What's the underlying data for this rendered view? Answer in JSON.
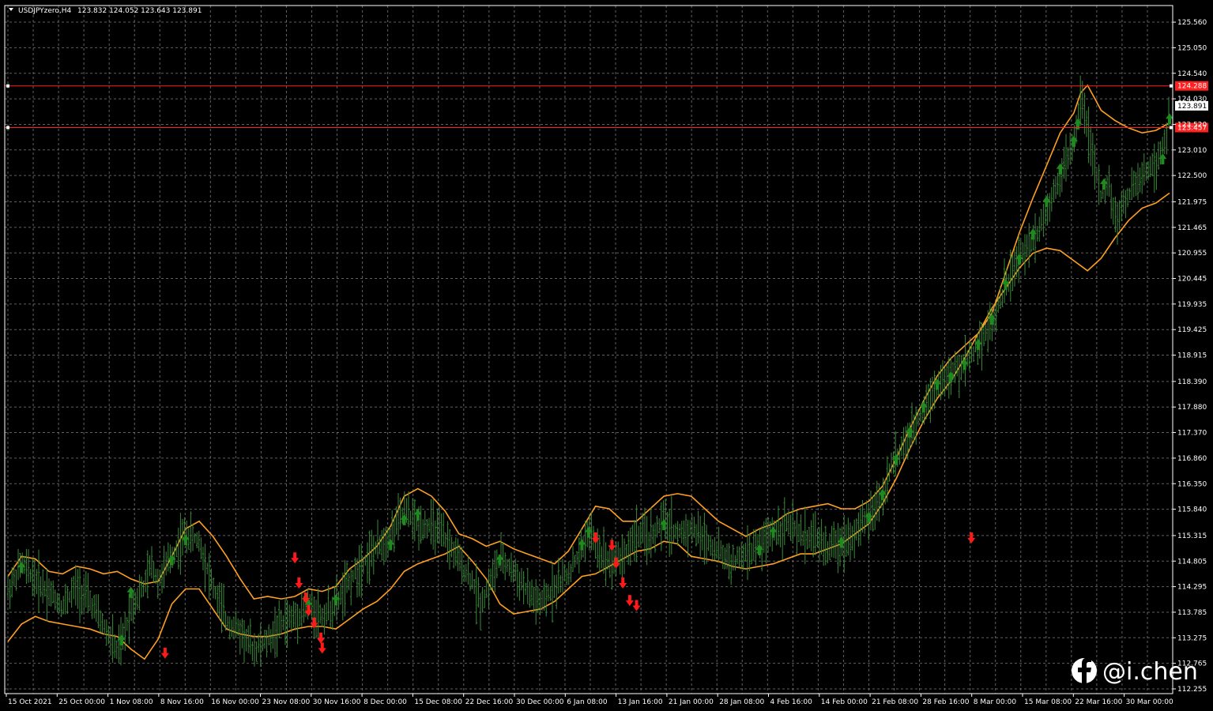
{
  "window": {
    "symbol_title": "USDJPYzero,H4",
    "ohlc_readout": "123.832 124.052 123.643 123.891"
  },
  "watermark": {
    "text": "@i.chen",
    "icon": "facebook-icon"
  },
  "colors": {
    "background": "#000000",
    "grid": "#7a7a7a",
    "axis": "#ffffff",
    "bars": "#3a8a3a",
    "band": "#ffa020",
    "buy_arrow": "#1f8a1f",
    "sell_arrow": "#ff1a1a",
    "hline": "#ff2020",
    "current_price_label_bg": "#ffffff"
  },
  "chart_data": {
    "type": "bar",
    "title": "USDJPYzero,H4",
    "timeframe": "H4",
    "ylim": [
      112.255,
      125.75
    ],
    "grid": true,
    "y_ticks": [
      "125.560",
      "125.050",
      "124.540",
      "124.030",
      "123.520",
      "123.010",
      "122.500",
      "121.975",
      "121.465",
      "120.955",
      "120.445",
      "119.935",
      "119.425",
      "118.915",
      "118.390",
      "117.880",
      "117.370",
      "116.860",
      "116.350",
      "115.840",
      "115.315",
      "114.805",
      "114.295",
      "113.785",
      "113.275",
      "112.765",
      "112.255"
    ],
    "x_ticks": [
      "15 Oct 2021",
      "25 Oct 00:00",
      "1 Nov 08:00",
      "8 Nov 16:00",
      "16 Nov 00:00",
      "23 Nov 08:00",
      "30 Nov 16:00",
      "8 Dec 00:00",
      "15 Dec 08:00",
      "22 Dec 16:00",
      "30 Dec 00:00",
      "6 Jan 08:00",
      "13 Jan 16:00",
      "21 Jan 00:00",
      "28 Jan 08:00",
      "4 Feb 16:00",
      "14 Feb 00:00",
      "21 Feb 08:00",
      "28 Feb 16:00",
      "8 Mar 00:00",
      "15 Mar 08:00",
      "22 Mar 16:00",
      "30 Mar 00:00"
    ],
    "price_path": [
      [
        0,
        114.2
      ],
      [
        1,
        114.75
      ],
      [
        2,
        114.45
      ],
      [
        3,
        114.2
      ],
      [
        4,
        113.9
      ],
      [
        5,
        114.3
      ],
      [
        6,
        114.0
      ],
      [
        7,
        113.5
      ],
      [
        8,
        113.0
      ],
      [
        8.4,
        113.2
      ],
      [
        9,
        113.9
      ],
      [
        10,
        114.3
      ],
      [
        10.5,
        114.75
      ],
      [
        11,
        114.4
      ],
      [
        12,
        114.9
      ],
      [
        13,
        115.35
      ],
      [
        14,
        115.2
      ],
      [
        15,
        114.3
      ],
      [
        16,
        113.6
      ],
      [
        17,
        113.4
      ],
      [
        18,
        113.05
      ],
      [
        19,
        113.2
      ],
      [
        20,
        113.55
      ],
      [
        21,
        113.7
      ],
      [
        22,
        113.9
      ],
      [
        23,
        113.7
      ],
      [
        24,
        113.95
      ],
      [
        25,
        114.4
      ],
      [
        26,
        114.8
      ],
      [
        27,
        115.05
      ],
      [
        27.5,
        115.2
      ],
      [
        28,
        115.35
      ],
      [
        29,
        115.8
      ],
      [
        30,
        115.55
      ],
      [
        31,
        115.5
      ],
      [
        32,
        115.25
      ],
      [
        33,
        114.8
      ],
      [
        34,
        114.4
      ],
      [
        34.6,
        113.95
      ],
      [
        35,
        114.2
      ],
      [
        36,
        114.85
      ],
      [
        37,
        114.6
      ],
      [
        38,
        114.2
      ],
      [
        39,
        113.9
      ],
      [
        40,
        114.3
      ],
      [
        41,
        114.55
      ],
      [
        42,
        115.05
      ],
      [
        42.5,
        115.45
      ],
      [
        43,
        115.1
      ],
      [
        44,
        114.8
      ],
      [
        45,
        114.9
      ],
      [
        46,
        115.35
      ],
      [
        47,
        115.25
      ],
      [
        48,
        115.6
      ],
      [
        49,
        115.35
      ],
      [
        50,
        115.45
      ],
      [
        51,
        115.25
      ],
      [
        52,
        115.0
      ],
      [
        53,
        114.75
      ],
      [
        54,
        114.95
      ],
      [
        55,
        115.1
      ],
      [
        56,
        115.4
      ],
      [
        57,
        115.55
      ],
      [
        58,
        115.3
      ],
      [
        59,
        115.3
      ],
      [
        60,
        115.05
      ],
      [
        61,
        115.2
      ],
      [
        62,
        115.35
      ],
      [
        63,
        115.7
      ],
      [
        64,
        116.1
      ],
      [
        64.5,
        116.6
      ],
      [
        65,
        116.9
      ],
      [
        66,
        117.25
      ],
      [
        67,
        117.9
      ],
      [
        68,
        118.35
      ],
      [
        69,
        118.5
      ],
      [
        70,
        118.75
      ],
      [
        71,
        119.15
      ],
      [
        72,
        119.55
      ],
      [
        73,
        120.3
      ],
      [
        74,
        120.85
      ],
      [
        75,
        121.2
      ],
      [
        76,
        121.8
      ],
      [
        77,
        122.55
      ],
      [
        78,
        123.1
      ],
      [
        78.3,
        123.7
      ],
      [
        78.6,
        124.2
      ],
      [
        79,
        123.4
      ],
      [
        79.5,
        122.7
      ],
      [
        80,
        122.05
      ],
      [
        80.5,
        122.4
      ],
      [
        81,
        121.6
      ],
      [
        82,
        122.1
      ],
      [
        83,
        122.5
      ],
      [
        84,
        122.75
      ],
      [
        84.8,
        123.3
      ],
      [
        85,
        123.85
      ]
    ],
    "upper_band_path": [
      [
        0,
        114.5
      ],
      [
        1,
        114.9
      ],
      [
        2,
        114.85
      ],
      [
        3,
        114.6
      ],
      [
        4,
        114.55
      ],
      [
        5,
        114.7
      ],
      [
        6,
        114.65
      ],
      [
        7,
        114.55
      ],
      [
        8,
        114.6
      ],
      [
        9,
        114.45
      ],
      [
        10,
        114.35
      ],
      [
        11,
        114.4
      ],
      [
        12,
        114.9
      ],
      [
        13,
        115.45
      ],
      [
        14,
        115.6
      ],
      [
        15,
        115.3
      ],
      [
        16,
        114.9
      ],
      [
        17,
        114.45
      ],
      [
        18,
        114.05
      ],
      [
        19,
        114.1
      ],
      [
        20,
        114.05
      ],
      [
        21,
        114.1
      ],
      [
        22,
        114.25
      ],
      [
        23,
        114.2
      ],
      [
        24,
        114.3
      ],
      [
        25,
        114.65
      ],
      [
        26,
        114.85
      ],
      [
        27,
        115.1
      ],
      [
        28,
        115.5
      ],
      [
        29,
        116.1
      ],
      [
        30,
        116.25
      ],
      [
        31,
        116.1
      ],
      [
        32,
        115.8
      ],
      [
        33,
        115.35
      ],
      [
        34,
        115.25
      ],
      [
        35,
        115.1
      ],
      [
        36,
        115.2
      ],
      [
        37,
        115.05
      ],
      [
        38,
        114.95
      ],
      [
        39,
        114.85
      ],
      [
        40,
        114.75
      ],
      [
        41,
        115.0
      ],
      [
        42,
        115.45
      ],
      [
        43,
        115.9
      ],
      [
        44,
        115.85
      ],
      [
        45,
        115.6
      ],
      [
        46,
        115.6
      ],
      [
        47,
        115.85
      ],
      [
        48,
        116.1
      ],
      [
        49,
        116.15
      ],
      [
        50,
        116.1
      ],
      [
        51,
        115.85
      ],
      [
        52,
        115.6
      ],
      [
        53,
        115.45
      ],
      [
        54,
        115.3
      ],
      [
        55,
        115.45
      ],
      [
        56,
        115.55
      ],
      [
        57,
        115.75
      ],
      [
        58,
        115.85
      ],
      [
        59,
        115.9
      ],
      [
        60,
        115.95
      ],
      [
        61,
        115.85
      ],
      [
        62,
        115.85
      ],
      [
        63,
        116.0
      ],
      [
        64,
        116.3
      ],
      [
        65,
        116.85
      ],
      [
        66,
        117.45
      ],
      [
        67,
        118.0
      ],
      [
        68,
        118.5
      ],
      [
        69,
        118.85
      ],
      [
        70,
        119.1
      ],
      [
        71,
        119.35
      ],
      [
        72,
        119.75
      ],
      [
        73,
        120.55
      ],
      [
        74,
        121.35
      ],
      [
        75,
        122.05
      ],
      [
        76,
        122.7
      ],
      [
        77,
        123.35
      ],
      [
        78,
        123.75
      ],
      [
        78.5,
        124.15
      ],
      [
        79,
        124.3
      ],
      [
        79.5,
        124.05
      ],
      [
        80,
        123.8
      ],
      [
        81,
        123.6
      ],
      [
        82,
        123.45
      ],
      [
        83,
        123.35
      ],
      [
        84,
        123.4
      ],
      [
        85,
        123.55
      ]
    ],
    "lower_band_path": [
      [
        0,
        113.2
      ],
      [
        1,
        113.55
      ],
      [
        2,
        113.7
      ],
      [
        3,
        113.6
      ],
      [
        4,
        113.55
      ],
      [
        5,
        113.5
      ],
      [
        6,
        113.45
      ],
      [
        7,
        113.35
      ],
      [
        8,
        113.3
      ],
      [
        9,
        113.05
      ],
      [
        10,
        112.85
      ],
      [
        11,
        113.25
      ],
      [
        12,
        113.95
      ],
      [
        13,
        114.25
      ],
      [
        14,
        114.25
      ],
      [
        15,
        113.85
      ],
      [
        16,
        113.45
      ],
      [
        17,
        113.35
      ],
      [
        18,
        113.3
      ],
      [
        19,
        113.3
      ],
      [
        20,
        113.35
      ],
      [
        21,
        113.45
      ],
      [
        22,
        113.5
      ],
      [
        23,
        113.5
      ],
      [
        24,
        113.45
      ],
      [
        25,
        113.65
      ],
      [
        26,
        113.85
      ],
      [
        27,
        114.0
      ],
      [
        28,
        114.25
      ],
      [
        29,
        114.6
      ],
      [
        30,
        114.75
      ],
      [
        31,
        114.85
      ],
      [
        32,
        114.95
      ],
      [
        33,
        115.1
      ],
      [
        34,
        114.8
      ],
      [
        35,
        114.45
      ],
      [
        36,
        113.95
      ],
      [
        37,
        113.75
      ],
      [
        38,
        113.8
      ],
      [
        39,
        113.85
      ],
      [
        40,
        114.0
      ],
      [
        41,
        114.25
      ],
      [
        42,
        114.5
      ],
      [
        43,
        114.55
      ],
      [
        44,
        114.7
      ],
      [
        45,
        114.85
      ],
      [
        46,
        115.0
      ],
      [
        47,
        115.05
      ],
      [
        48,
        115.2
      ],
      [
        49,
        115.15
      ],
      [
        50,
        114.9
      ],
      [
        51,
        114.85
      ],
      [
        52,
        114.8
      ],
      [
        53,
        114.7
      ],
      [
        54,
        114.65
      ],
      [
        55,
        114.7
      ],
      [
        56,
        114.75
      ],
      [
        57,
        114.85
      ],
      [
        58,
        114.95
      ],
      [
        59,
        114.95
      ],
      [
        60,
        115.05
      ],
      [
        61,
        115.15
      ],
      [
        62,
        115.35
      ],
      [
        63,
        115.55
      ],
      [
        64,
        115.95
      ],
      [
        65,
        116.45
      ],
      [
        66,
        117.05
      ],
      [
        67,
        117.6
      ],
      [
        68,
        118.05
      ],
      [
        69,
        118.4
      ],
      [
        70,
        118.85
      ],
      [
        71,
        119.35
      ],
      [
        72,
        119.85
      ],
      [
        73,
        120.25
      ],
      [
        74,
        120.65
      ],
      [
        75,
        120.95
      ],
      [
        76,
        121.05
      ],
      [
        77,
        121.0
      ],
      [
        78,
        120.8
      ],
      [
        79,
        120.6
      ],
      [
        80,
        120.85
      ],
      [
        81,
        121.25
      ],
      [
        82,
        121.6
      ],
      [
        83,
        121.85
      ],
      [
        84,
        121.95
      ],
      [
        85,
        122.15
      ]
    ],
    "buy_signals": [
      [
        1,
        114.65
      ],
      [
        8.3,
        113.2
      ],
      [
        9,
        114.15
      ],
      [
        12,
        114.8
      ],
      [
        13,
        115.2
      ],
      [
        22,
        113.9
      ],
      [
        24,
        114.0
      ],
      [
        28,
        115.1
      ],
      [
        29,
        115.6
      ],
      [
        30,
        115.7
      ],
      [
        36,
        114.8
      ],
      [
        42,
        115.1
      ],
      [
        42.5,
        115.35
      ],
      [
        48,
        115.5
      ],
      [
        55,
        115.0
      ],
      [
        56,
        115.35
      ],
      [
        61,
        115.15
      ],
      [
        63,
        115.65
      ],
      [
        64,
        116.1
      ],
      [
        65,
        116.8
      ],
      [
        66,
        117.35
      ],
      [
        67,
        117.85
      ],
      [
        68,
        118.3
      ],
      [
        69,
        118.45
      ],
      [
        70,
        118.7
      ],
      [
        71,
        119.1
      ],
      [
        72,
        119.6
      ],
      [
        73,
        120.3
      ],
      [
        74,
        120.8
      ],
      [
        75,
        121.3
      ],
      [
        76,
        121.95
      ],
      [
        77,
        122.6
      ],
      [
        78,
        123.15
      ],
      [
        78.3,
        123.5
      ],
      [
        80.2,
        122.3
      ],
      [
        84.5,
        122.8
      ],
      [
        85,
        123.6
      ]
    ],
    "sell_signals": [
      [
        11.5,
        113.0
      ],
      [
        21,
        114.9
      ],
      [
        21.3,
        114.4
      ],
      [
        21.8,
        114.1
      ],
      [
        22,
        113.85
      ],
      [
        22.4,
        113.6
      ],
      [
        22.9,
        113.3
      ],
      [
        23,
        113.1
      ],
      [
        43,
        115.3
      ],
      [
        44.2,
        115.15
      ],
      [
        44.5,
        114.8
      ],
      [
        45,
        114.4
      ],
      [
        45.5,
        114.05
      ],
      [
        46,
        113.95
      ],
      [
        70.5,
        115.3
      ]
    ],
    "horizontal_lines": [
      {
        "value": 124.288,
        "label": "124.288"
      },
      {
        "value": 123.457,
        "label": "123.457"
      }
    ],
    "current_price": {
      "value": 123.891,
      "label": "123.891"
    }
  }
}
